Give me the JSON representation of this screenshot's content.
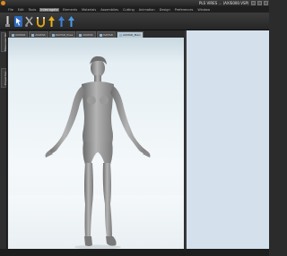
{
  "window": {
    "title": "PLS VIRES ... (AXIS000.VSP)"
  },
  "menu": [
    "File",
    "Edit",
    "Tools",
    "Interrogate",
    "Elements",
    "Materials",
    "Assemblies",
    "Cutting",
    "Animation",
    "Design",
    "Preferences",
    "Window"
  ],
  "active_menu_index": 3,
  "toolbar": {
    "buttons": [
      "pin-tool",
      "cursor-tool",
      "cut-tool",
      "magnet-tool",
      "stitch-tool",
      "seam-tool",
      "flag-tool"
    ]
  },
  "side_rail": {
    "labels": [
      "Measures Tab",
      "Properties"
    ]
  },
  "tabs": [
    {
      "label": "AVATAR"
    },
    {
      "label": "AVATAR"
    },
    {
      "label": "AVATAR_Pose"
    },
    {
      "label": "AVATAR"
    },
    {
      "label": "AVATAR"
    },
    {
      "label": "AVATAR_Main"
    }
  ],
  "active_tab_index": 5,
  "colors": {
    "accent": "#1e63b4",
    "viewport_bg": "#eef4f8",
    "panel_bg": "#d4e1ec"
  }
}
